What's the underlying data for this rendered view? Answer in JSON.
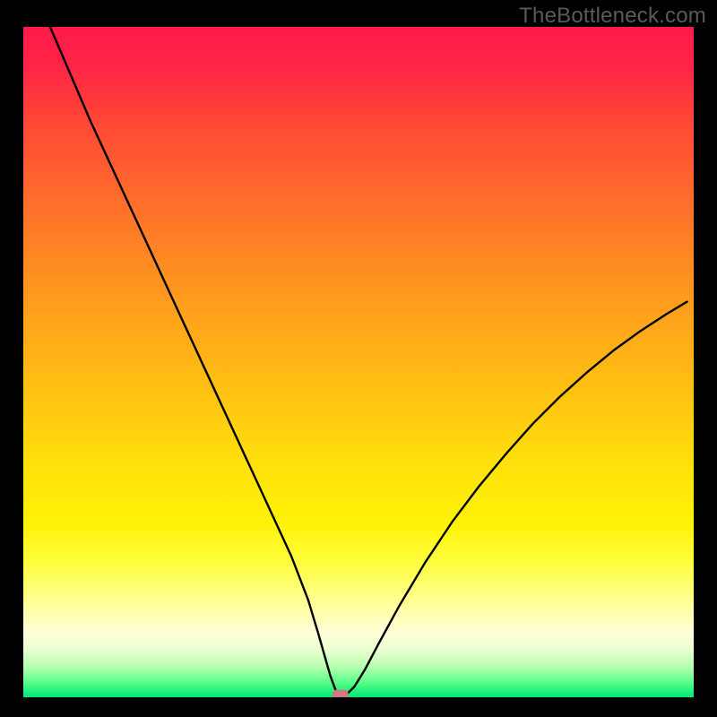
{
  "watermark": "TheBottleneck.com",
  "chart_data": {
    "type": "line",
    "title": "",
    "xlabel": "",
    "ylabel": "",
    "xlim": [
      0,
      100
    ],
    "ylim": [
      0,
      100
    ],
    "grid": false,
    "legend": false,
    "background_gradient": [
      {
        "stop": 0.0,
        "color": "#ff1a4b"
      },
      {
        "stop": 0.05,
        "color": "#ff2247"
      },
      {
        "stop": 0.15,
        "color": "#ff4a35"
      },
      {
        "stop": 0.25,
        "color": "#ff6a2c"
      },
      {
        "stop": 0.35,
        "color": "#ff8a22"
      },
      {
        "stop": 0.45,
        "color": "#ffa81a"
      },
      {
        "stop": 0.55,
        "color": "#ffc312"
      },
      {
        "stop": 0.65,
        "color": "#ffe00c"
      },
      {
        "stop": 0.74,
        "color": "#fff207"
      },
      {
        "stop": 0.8,
        "color": "#ffff40"
      },
      {
        "stop": 0.86,
        "color": "#ffff9a"
      },
      {
        "stop": 0.9,
        "color": "#ffffd6"
      },
      {
        "stop": 0.93,
        "color": "#eaffd0"
      },
      {
        "stop": 0.955,
        "color": "#b6ffb0"
      },
      {
        "stop": 0.975,
        "color": "#63ff8c"
      },
      {
        "stop": 1.0,
        "color": "#00e874"
      }
    ],
    "curve": {
      "x": [
        4,
        7,
        10,
        13,
        16,
        19,
        22,
        25,
        28,
        31,
        34,
        37,
        40,
        42.5,
        44,
        45,
        45.8,
        46.5,
        47,
        48,
        49.4,
        51,
        53,
        56,
        60,
        64,
        68,
        72,
        76,
        80,
        84,
        88,
        92,
        96,
        99
      ],
      "y": [
        100,
        93,
        86,
        79.5,
        73,
        66.5,
        60,
        53.5,
        47,
        40.5,
        34,
        27.5,
        21,
        14.5,
        9.5,
        6,
        3.2,
        1.3,
        0.2,
        0.2,
        1.6,
        4.2,
        8.0,
        13.5,
        20.2,
        26.2,
        31.5,
        36.3,
        40.8,
        44.8,
        48.4,
        51.7,
        54.6,
        57.2,
        59.0
      ]
    },
    "marker": {
      "x": 47.3,
      "y": 0.4,
      "color": "#cf7a7f"
    }
  }
}
